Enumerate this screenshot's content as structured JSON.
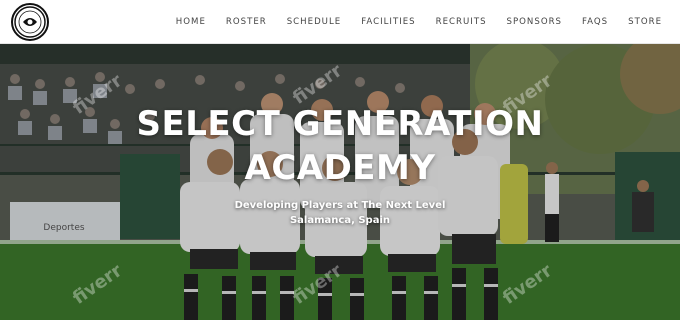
{
  "brand": {
    "logo_text": "SELECT GENERATION"
  },
  "nav": {
    "items": [
      {
        "label": "HOME"
      },
      {
        "label": "ROSTER"
      },
      {
        "label": "SCHEDULE"
      },
      {
        "label": "FACILITIES"
      },
      {
        "label": "RECRUITS"
      },
      {
        "label": "SPONSORS"
      },
      {
        "label": "FAQS"
      },
      {
        "label": "STORE"
      }
    ]
  },
  "hero": {
    "title_line1": "SELECT GENERATION",
    "title_line2": "ACADEMY",
    "subtitle_line1": "Developing Players at The Next Level",
    "subtitle_line2": "Salamanca, Spain",
    "banner_text": "Deportes",
    "watermark": "fiverr"
  },
  "colors": {
    "nav_bg": "#ffffff",
    "nav_text": "#444444",
    "hero_text": "#ffffff",
    "kit": "#eeeeee"
  }
}
